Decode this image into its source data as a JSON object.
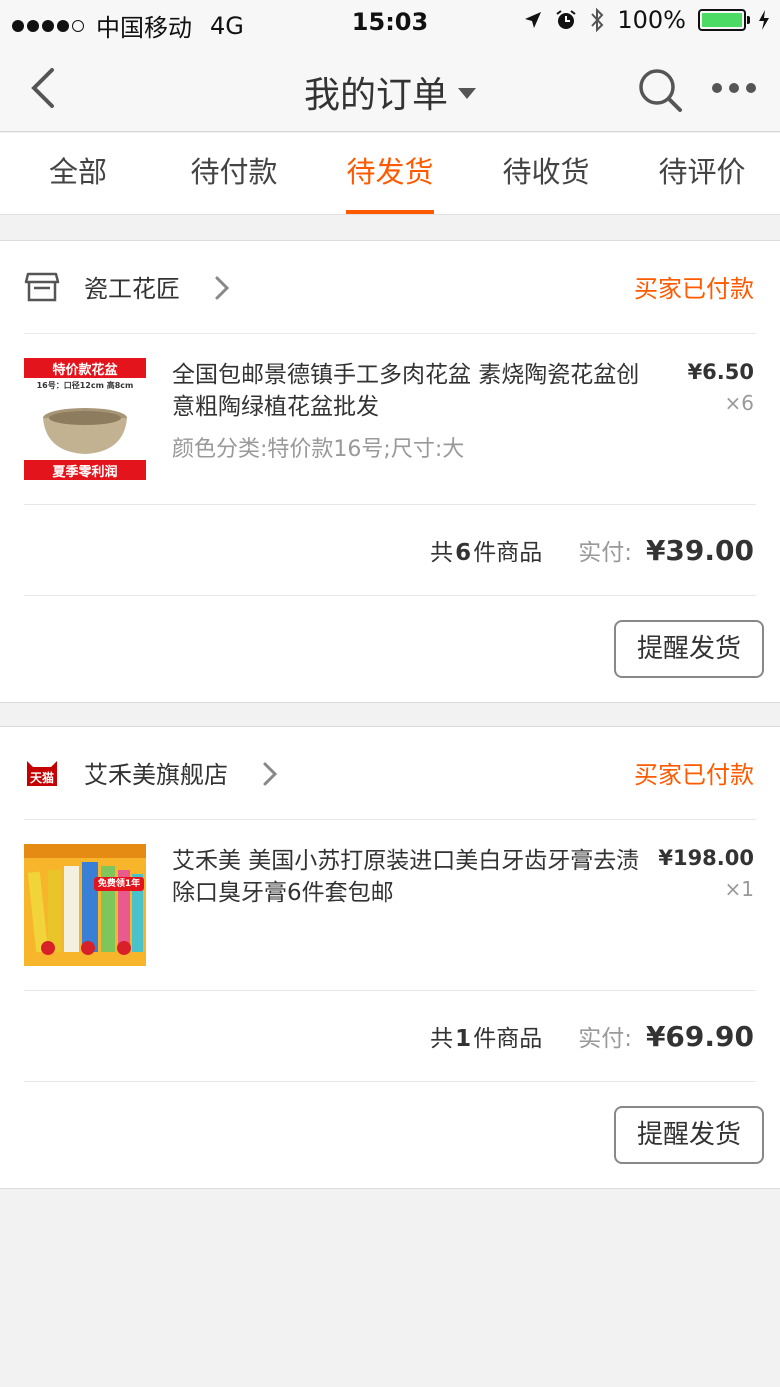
{
  "status_bar": {
    "carrier": "中国移动",
    "network": "4G",
    "time": "15:03",
    "battery": "100%"
  },
  "nav": {
    "title": "我的订单",
    "back_icon": "chevron-left-icon",
    "search_icon": "search-icon",
    "more_icon": "more-icon"
  },
  "tabs": [
    {
      "label": "全部"
    },
    {
      "label": "待付款"
    },
    {
      "label": "待发货",
      "active": true
    },
    {
      "label": "待收货"
    },
    {
      "label": "待评价"
    }
  ],
  "colors": {
    "accent": "#ff5a00",
    "battery": "#4cd964"
  },
  "orders": [
    {
      "shop_name": "瓷工花匠",
      "shop_icon": "store-icon",
      "status": "买家已付款",
      "item": {
        "title": "全国包邮景德镇手工多肉花盆 素烧陶瓷花盆创意粗陶绿植花盆批发",
        "spec": "颜色分类:特价款16号;尺寸:大",
        "price": "¥6.50",
        "qty": "×6",
        "image_top": "特价款花盆",
        "image_mid": "16号：口径12cm 高8cm",
        "image_bottom": "夏季零利润"
      },
      "summary_prefix": "共",
      "summary_count": "6",
      "summary_suffix": "件商品",
      "paid_label": "实付:",
      "paid_amount": "¥39.00",
      "button": "提醒发货"
    },
    {
      "shop_name": "艾禾美旗舰店",
      "shop_icon": "tmall-icon",
      "status": "买家已付款",
      "item": {
        "title": "艾禾美 美国小苏打原装进口美白牙齿牙膏去渍除口臭牙膏6件套包邮",
        "spec": "",
        "price": "¥198.00",
        "qty": "×1",
        "image_badge": "免费领1年"
      },
      "summary_prefix": "共",
      "summary_count": "1",
      "summary_suffix": "件商品",
      "paid_label": "实付:",
      "paid_amount": "¥69.90",
      "button": "提醒发货"
    }
  ]
}
